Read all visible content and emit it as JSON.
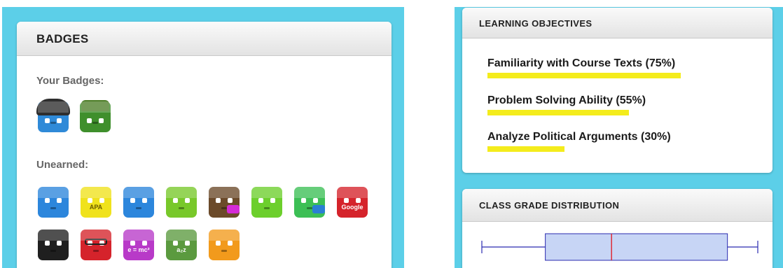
{
  "badges_panel": {
    "title": "BADGES",
    "your_badges_label": "Your Badges:",
    "unearned_label": "Unearned:",
    "earned": [
      {
        "icon": "vader-helmet-robot-icon",
        "color": "#2f8ad8",
        "style": "helmet"
      },
      {
        "icon": "army-robot-icon",
        "color": "#3f8f2c",
        "style": "army"
      }
    ],
    "unearned": [
      {
        "icon": "notebook-robot-icon",
        "color": "#2c86dc",
        "style": "plain"
      },
      {
        "icon": "apa-robot-icon",
        "color": "#f0e21c",
        "style": "tag",
        "text": "APA"
      },
      {
        "icon": "thinking-robot-icon",
        "color": "#2c86dc",
        "style": "plain"
      },
      {
        "icon": "checklist-robot-icon",
        "color": "#78c82a",
        "style": "plain"
      },
      {
        "icon": "wallet-robot-icon",
        "color": "#6b4a2a",
        "style": "accent",
        "accent": "#d52bd7"
      },
      {
        "icon": "pirate-robot-icon",
        "color": "#6ccf2c",
        "style": "plain"
      },
      {
        "icon": "twin-robots-icon",
        "color": "#3cbf55",
        "style": "accent",
        "accent": "#2a7fd4"
      },
      {
        "icon": "google-robot-icon",
        "color": "#d5232b",
        "style": "tag",
        "text": "Google"
      },
      {
        "icon": "checkered-flag-robot-icon",
        "color": "#1f1f1f",
        "style": "plain"
      },
      {
        "icon": "3d-glasses-robot-icon",
        "color": "#d5232b",
        "style": "glasses"
      },
      {
        "icon": "emc2-robot-icon",
        "color": "#b83ac8",
        "style": "tag",
        "text": "e = mc²"
      },
      {
        "icon": "a2z-robot-icon",
        "color": "#5b9a3f",
        "style": "tag",
        "text": "a₂z"
      },
      {
        "icon": "orange-robot-icon",
        "color": "#f29a1c",
        "style": "plain"
      }
    ]
  },
  "objectives_panel": {
    "title": "LEARNING OBJECTIVES",
    "bar_color": "#f4ec1c",
    "items": [
      {
        "label": "Familiarity with Course Texts (75%)",
        "percent": 75
      },
      {
        "label": "Problem Solving Ability (55%)",
        "percent": 55
      },
      {
        "label": "Analyze Political Arguments (30%)",
        "percent": 30
      }
    ]
  },
  "grades_panel": {
    "title": "CLASS GRADE DISTRIBUTION",
    "box_fill": "#c7d5f5",
    "box_stroke": "#2b2bb0",
    "median_color": "#e0202a"
  },
  "chart_data": {
    "type": "box",
    "title": "CLASS GRADE DISTRIBUTION",
    "min": 0,
    "q1": 23,
    "median": 47,
    "q3": 89,
    "max": 100
  }
}
